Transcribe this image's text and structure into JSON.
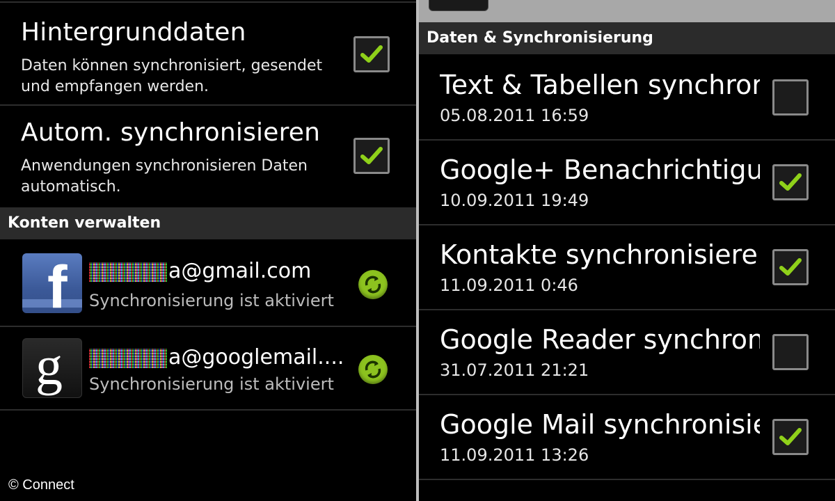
{
  "left": {
    "settings": [
      {
        "title": "Hintergrunddaten",
        "subtitle": "Daten können synchronisiert, gesendet und empfangen werden.",
        "checked": true
      },
      {
        "title": "Autom. synchronisieren",
        "subtitle": "Anwendungen synchronisieren Daten automatisch.",
        "checked": true
      }
    ],
    "section_header": "Konten verwalten",
    "accounts": [
      {
        "icon": "facebook-icon",
        "email_suffix": "a@gmail.com",
        "status": "Synchronisierung ist aktiviert"
      },
      {
        "icon": "google-icon",
        "email_suffix": "a@googlemail....",
        "status": "Synchronisierung ist aktiviert"
      }
    ],
    "copyright": "© Connect"
  },
  "right": {
    "section_header": "Daten & Synchronisierung",
    "items": [
      {
        "title": "Text & Tabellen synchror",
        "date": "05.08.2011 16:59",
        "checked": false
      },
      {
        "title": "Google+ Benachrichtigur",
        "date": "10.09.2011 19:49",
        "checked": true
      },
      {
        "title": "Kontakte synchronisieren",
        "date": "11.09.2011 0:46",
        "checked": true
      },
      {
        "title": "Google Reader synchroni",
        "date": "31.07.2011 21:21",
        "checked": false
      },
      {
        "title": "Google Mail synchronisie",
        "date": "11.09.2011 13:26",
        "checked": true
      }
    ]
  },
  "colors": {
    "check": "#8fd11a",
    "sync": "#8cc21f",
    "header_bg": "#2b2b2b"
  }
}
